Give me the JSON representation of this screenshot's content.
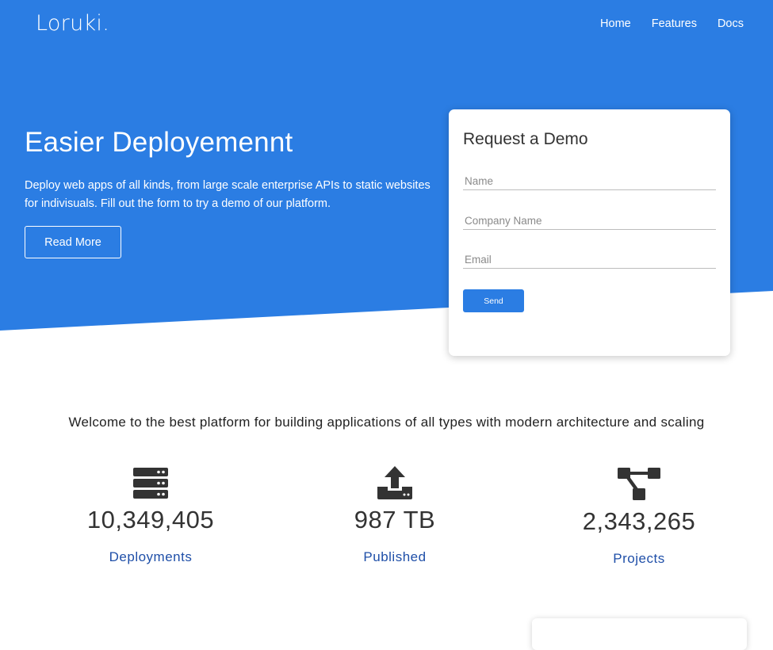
{
  "brand": {
    "logo": "Loruki.",
    "accent_color": "#2b7de3",
    "link_color": "#1f4fa8"
  },
  "nav": {
    "items": [
      "Home",
      "Features",
      "Docs"
    ]
  },
  "hero": {
    "title": "Easier Deployemennt",
    "subtitle": "Deploy web apps of all kinds, from large scale enterprise APIs to static websites for indivisuals. Fill out the form to try a demo of our platform.",
    "cta_label": "Read More"
  },
  "demo_form": {
    "title": "Request a Demo",
    "fields": [
      {
        "placeholder": "Name",
        "value": ""
      },
      {
        "placeholder": "Company Name",
        "value": ""
      },
      {
        "placeholder": "Email",
        "value": ""
      }
    ],
    "submit_label": "Send"
  },
  "stats": {
    "heading": "Welcome to the best platform for building applications of all types with modern architecture and scaling",
    "items": [
      {
        "icon": "server-icon",
        "value": "10,349,405",
        "label": "Deployments"
      },
      {
        "icon": "upload-icon",
        "value": "987 TB",
        "label": "Published"
      },
      {
        "icon": "project-diagram-icon",
        "value": "2,343,265",
        "label": "Projects"
      }
    ]
  }
}
